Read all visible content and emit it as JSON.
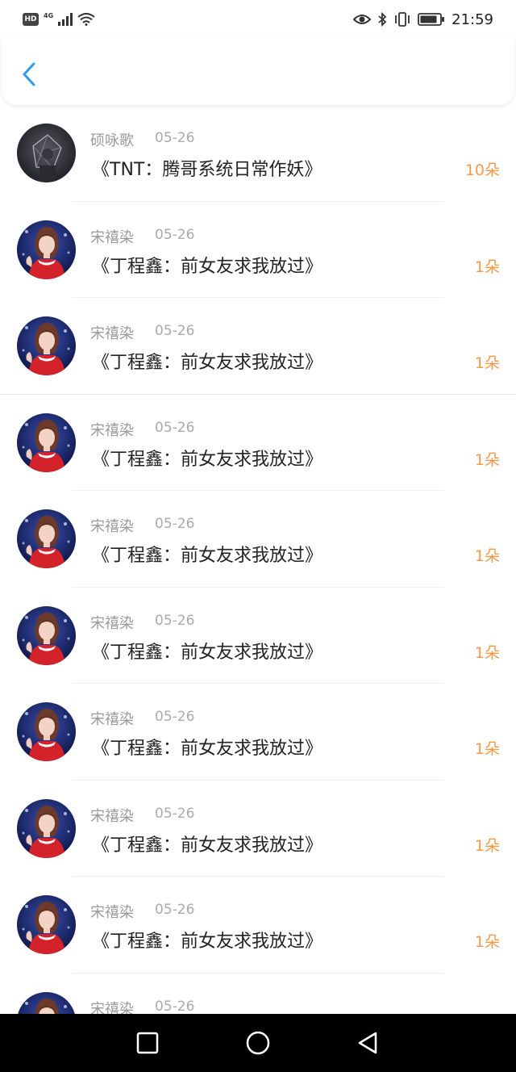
{
  "status_bar": {
    "network_badge": "HD",
    "network_type": "4G",
    "time": "21:59",
    "icons": [
      "signal-icon",
      "wifi-icon",
      "eye-icon",
      "bluetooth-icon",
      "vibrate-icon",
      "battery-icon"
    ]
  },
  "header": {
    "back_icon": "chevron-left-icon",
    "accent_color": "#2f9be6"
  },
  "list": {
    "count_color": "#f39a4a",
    "items": [
      {
        "name": "硕咏歌",
        "date": "05-26",
        "title": "《TNT：腾哥系统日常作妖》",
        "count": "10朵",
        "avatar": "dark-avatar"
      },
      {
        "name": "宋禧染",
        "date": "05-26",
        "title": "《丁程鑫：前女友求我放过》",
        "count": "1朵",
        "avatar": "red-dress-avatar"
      },
      {
        "name": "宋禧染",
        "date": "05-26",
        "title": "《丁程鑫：前女友求我放过》",
        "count": "1朵",
        "avatar": "red-dress-avatar"
      },
      {
        "name": "宋禧染",
        "date": "05-26",
        "title": "《丁程鑫：前女友求我放过》",
        "count": "1朵",
        "avatar": "red-dress-avatar"
      },
      {
        "name": "宋禧染",
        "date": "05-26",
        "title": "《丁程鑫：前女友求我放过》",
        "count": "1朵",
        "avatar": "red-dress-avatar"
      },
      {
        "name": "宋禧染",
        "date": "05-26",
        "title": "《丁程鑫：前女友求我放过》",
        "count": "1朵",
        "avatar": "red-dress-avatar"
      },
      {
        "name": "宋禧染",
        "date": "05-26",
        "title": "《丁程鑫：前女友求我放过》",
        "count": "1朵",
        "avatar": "red-dress-avatar"
      },
      {
        "name": "宋禧染",
        "date": "05-26",
        "title": "《丁程鑫：前女友求我放过》",
        "count": "1朵",
        "avatar": "red-dress-avatar"
      },
      {
        "name": "宋禧染",
        "date": "05-26",
        "title": "《丁程鑫：前女友求我放过》",
        "count": "1朵",
        "avatar": "red-dress-avatar"
      },
      {
        "name": "宋禧染",
        "date": "05-26",
        "title": "",
        "count": "",
        "avatar": "red-dress-avatar"
      }
    ]
  },
  "nav_bar": {
    "buttons": [
      "recent-apps-icon",
      "home-icon",
      "back-triangle-icon"
    ]
  }
}
